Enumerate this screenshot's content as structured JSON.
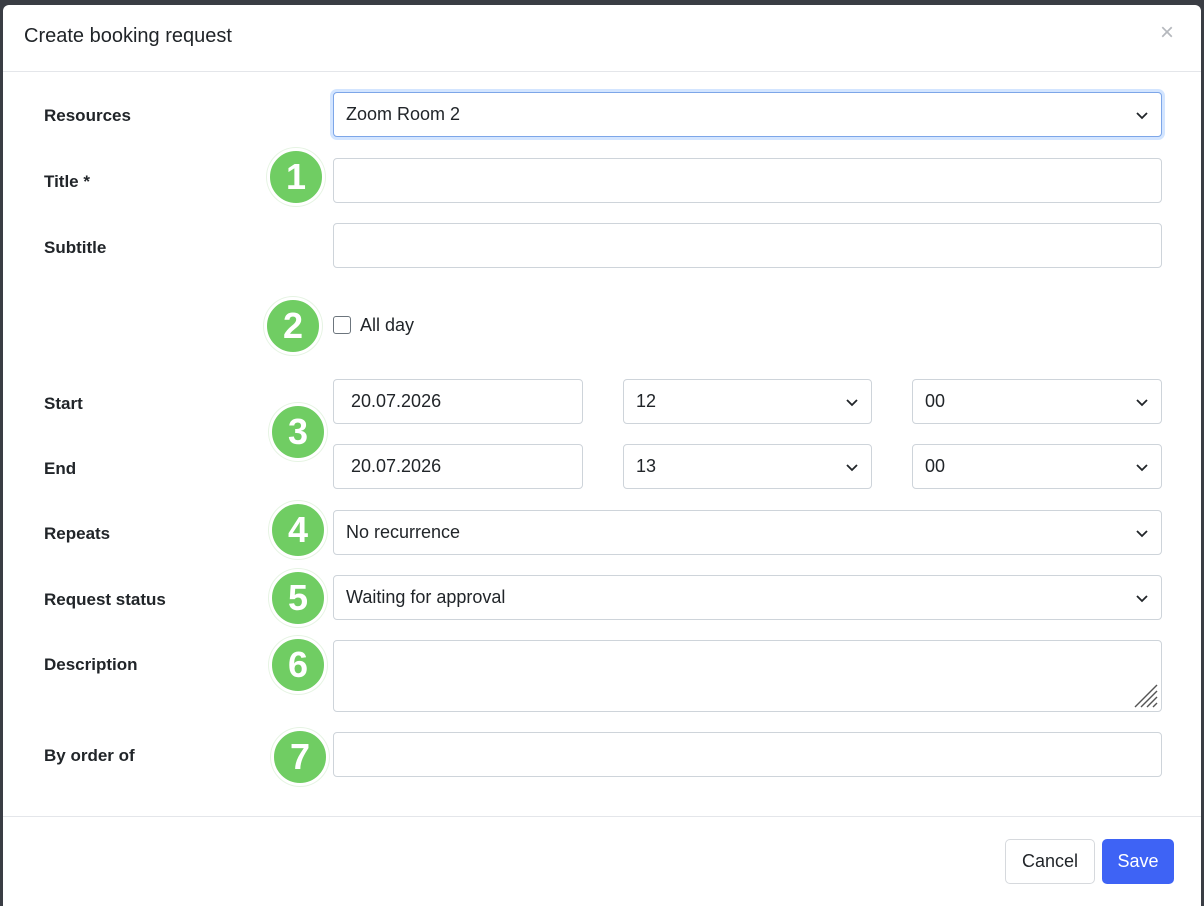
{
  "modal": {
    "title": "Create booking request",
    "close_icon": "close-icon"
  },
  "form": {
    "resources": {
      "label": "Resources",
      "value": "Zoom Room 2"
    },
    "title": {
      "label": "Title *",
      "value": ""
    },
    "subtitle": {
      "label": "Subtitle",
      "value": ""
    },
    "all_day": {
      "label": "All day",
      "checked": false
    },
    "start": {
      "label": "Start",
      "date": "20.07.2026",
      "hour": "12",
      "minute": "00"
    },
    "end": {
      "label": "End",
      "date": "20.07.2026",
      "hour": "13",
      "minute": "00"
    },
    "repeats": {
      "label": "Repeats",
      "value": "No recurrence"
    },
    "request_status": {
      "label": "Request status",
      "value": "Waiting for approval"
    },
    "description": {
      "label": "Description",
      "value": ""
    },
    "by_order_of": {
      "label": "By order of",
      "value": ""
    }
  },
  "badges": [
    "1",
    "2",
    "3",
    "4",
    "5",
    "6",
    "7"
  ],
  "footer": {
    "cancel_label": "Cancel",
    "save_label": "Save"
  },
  "colors": {
    "badge": "#70cd63",
    "primary": "#3e63f5",
    "focus_border": "#7da6e8"
  }
}
